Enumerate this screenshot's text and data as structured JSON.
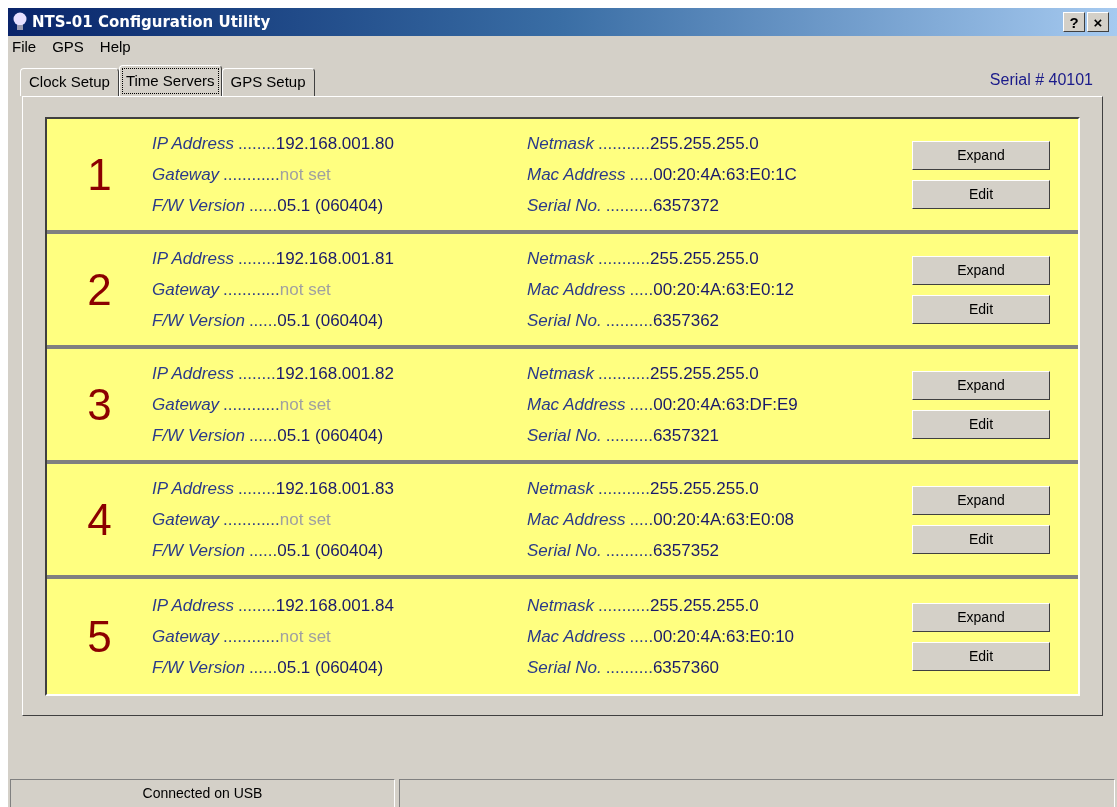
{
  "window": {
    "title": "NTS-01 Configuration Utility",
    "controls": [
      "?",
      "×"
    ]
  },
  "menu": [
    "File",
    "GPS",
    "Help"
  ],
  "tabs": [
    {
      "label": "Clock Setup",
      "selected": false
    },
    {
      "label": "Time Servers",
      "selected": true
    },
    {
      "label": "GPS Setup",
      "selected": false
    }
  ],
  "serial": "Serial # 40101",
  "servers": [
    {
      "number": "1",
      "fields": [
        {
          "label": "IP Address",
          "leader": "........",
          "value": "192.168.001.80",
          "dim": false
        },
        {
          "label": "Netmask",
          "leader": "...........",
          "value": "255.255.255.0",
          "dim": false
        },
        {
          "label": "Gateway",
          "leader": "............",
          "value": "not set",
          "dim": true
        },
        {
          "label": "Mac Address",
          "leader": ".....",
          "value": "00:20:4A:63:E0:1C",
          "dim": false
        },
        {
          "label": "F/W Version",
          "leader": "......",
          "value": "05.1 (060404)",
          "dim": false
        },
        {
          "label": "Serial No.",
          "leader": "..........",
          "value": "6357372",
          "dim": false
        }
      ],
      "buttons": [
        "Expand",
        "Edit"
      ]
    },
    {
      "number": "2",
      "fields": [
        {
          "label": "IP Address",
          "leader": "........",
          "value": "192.168.001.81",
          "dim": false
        },
        {
          "label": "Netmask",
          "leader": "...........",
          "value": "255.255.255.0",
          "dim": false
        },
        {
          "label": "Gateway",
          "leader": "............",
          "value": "not set",
          "dim": true
        },
        {
          "label": "Mac Address",
          "leader": ".....",
          "value": "00:20:4A:63:E0:12",
          "dim": false
        },
        {
          "label": "F/W Version",
          "leader": "......",
          "value": "05.1 (060404)",
          "dim": false
        },
        {
          "label": "Serial No.",
          "leader": "..........",
          "value": "6357362",
          "dim": false
        }
      ],
      "buttons": [
        "Expand",
        "Edit"
      ]
    },
    {
      "number": "3",
      "fields": [
        {
          "label": "IP Address",
          "leader": "........",
          "value": "192.168.001.82",
          "dim": false
        },
        {
          "label": "Netmask",
          "leader": "...........",
          "value": "255.255.255.0",
          "dim": false
        },
        {
          "label": "Gateway",
          "leader": "............",
          "value": "not set",
          "dim": true
        },
        {
          "label": "Mac Address",
          "leader": ".....",
          "value": "00:20:4A:63:DF:E9",
          "dim": false
        },
        {
          "label": "F/W Version",
          "leader": "......",
          "value": "05.1 (060404)",
          "dim": false
        },
        {
          "label": "Serial No.",
          "leader": "..........",
          "value": "6357321",
          "dim": false
        }
      ],
      "buttons": [
        "Expand",
        "Edit"
      ]
    },
    {
      "number": "4",
      "fields": [
        {
          "label": "IP Address",
          "leader": "........",
          "value": "192.168.001.83",
          "dim": false
        },
        {
          "label": "Netmask",
          "leader": "...........",
          "value": "255.255.255.0",
          "dim": false
        },
        {
          "label": "Gateway",
          "leader": "............",
          "value": "not set",
          "dim": true
        },
        {
          "label": "Mac Address",
          "leader": ".....",
          "value": "00:20:4A:63:E0:08",
          "dim": false
        },
        {
          "label": "F/W Version",
          "leader": "......",
          "value": "05.1 (060404)",
          "dim": false
        },
        {
          "label": "Serial No.",
          "leader": "..........",
          "value": "6357352",
          "dim": false
        }
      ],
      "buttons": [
        "Expand",
        "Edit"
      ]
    },
    {
      "number": "5",
      "fields": [
        {
          "label": "IP Address",
          "leader": "........",
          "value": "192.168.001.84",
          "dim": false
        },
        {
          "label": "Netmask",
          "leader": "...........",
          "value": "255.255.255.0",
          "dim": false
        },
        {
          "label": "Gateway",
          "leader": "............",
          "value": "not set",
          "dim": true
        },
        {
          "label": "Mac Address",
          "leader": ".....",
          "value": "00:20:4A:63:E0:10",
          "dim": false
        },
        {
          "label": "F/W Version",
          "leader": "......",
          "value": "05.1 (060404)",
          "dim": false
        },
        {
          "label": "Serial No.",
          "leader": "..........",
          "value": "6357360",
          "dim": false
        }
      ],
      "buttons": [
        "Expand",
        "Edit"
      ]
    }
  ],
  "status_bar": [
    "Connected on USB"
  ]
}
